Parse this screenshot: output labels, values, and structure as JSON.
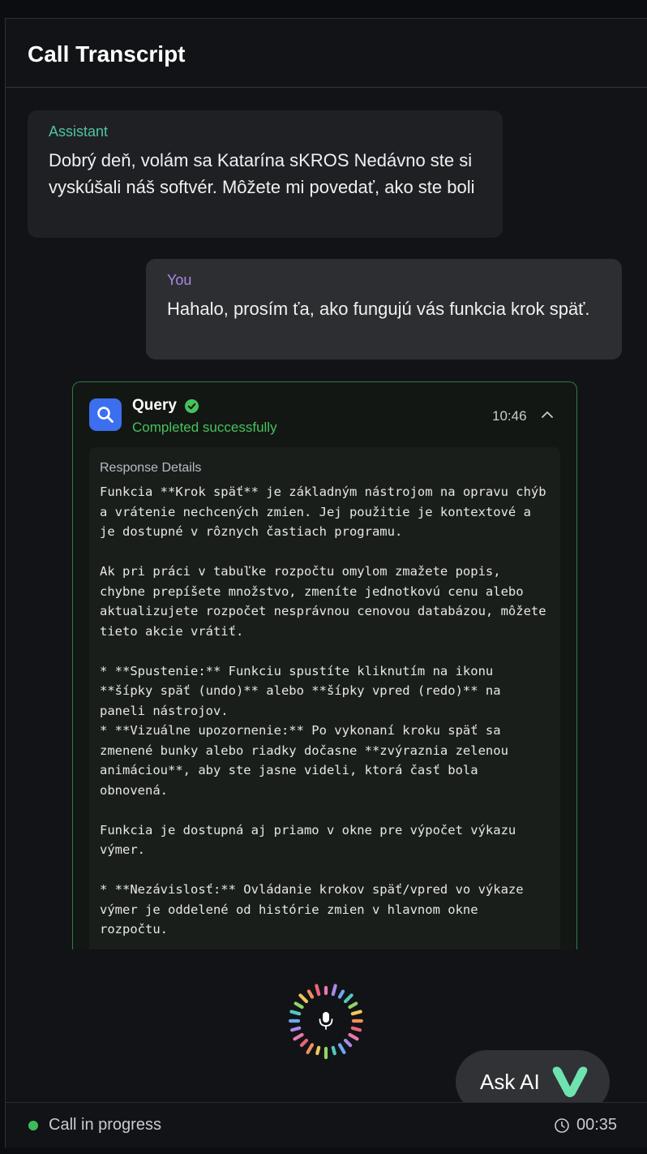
{
  "header": {
    "title": "Call Transcript"
  },
  "messages": [
    {
      "speaker": "Assistant",
      "text": "Dobrý deň, volám sa Katarína sKROS Nedávno ste si vyskúšali náš softvér. Môžete mi povedať, ako ste boli"
    },
    {
      "speaker": "You",
      "text": "Hahalo, prosím ťa, ako fungujú vás funkcia krok späť."
    }
  ],
  "query": {
    "title": "Query",
    "status": "Completed successfully",
    "time": "10:46",
    "details_label": "Response Details",
    "details_text": "Funkcia **Krok späť** je základným nástrojom na opravu chýb a vrátenie nechcených zmien. Jej použitie je kontextové a je dostupné v rôznych častiach programu.\n\nAk pri práci v tabuľke rozpočtu omylom zmažete popis, chybne prepíšete množstvo, zmeníte jednotkovú cenu alebo aktualizujete rozpočet nesprávnou cenovou databázou, môžete tieto akcie vrátiť.\n\n* **Spustenie:** Funkciu spustíte kliknutím na ikonu **šípky späť (undo)** alebo **šípky vpred (redo)** na paneli nástrojov.\n* **Vizuálne upozornenie:** Po vykonaní kroku späť sa zmenené bunky alebo riadky dočasne **zvýraznia zelenou animáciou**, aby ste jasne videli, ktorá časť bola obnovená.\n\nFunkcia je dostupná aj priamo v okne pre výpočet výkazu výmer.\n\n* **Nezávislosť:** Ovládanie krokov späť/vpred vo výkaze výmer je oddelené od histórie zmien v hlavnom okne rozpočtu."
  },
  "ask_ai": {
    "label": "Ask AI"
  },
  "statusbar": {
    "status": "Call in progress",
    "duration": "00:35"
  },
  "colors": {
    "assistant_label": "#4fc3a1",
    "user_label": "#a889e8",
    "success": "#46c25b",
    "query_icon_bg": "#3b6ff0",
    "logo": "#6ee3b0"
  },
  "icons": [
    "search-icon",
    "check-circle-icon",
    "chevron-up-icon",
    "microphone-icon",
    "v-logo-icon",
    "clock-icon"
  ]
}
